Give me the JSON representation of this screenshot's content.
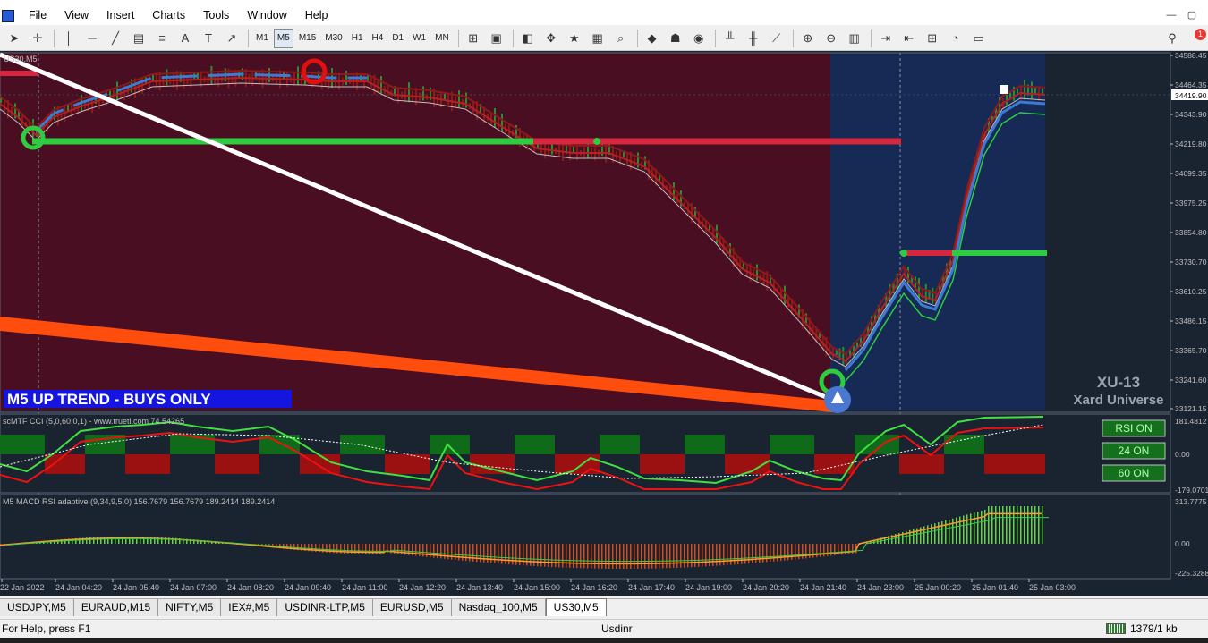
{
  "window": {
    "title": "",
    "controls": [
      "—",
      "▢"
    ]
  },
  "menu": [
    "File",
    "View",
    "Insert",
    "Charts",
    "Tools",
    "Window",
    "Help"
  ],
  "toolbar": {
    "timeframes": [
      "M1",
      "M5",
      "M15",
      "M30",
      "H1",
      "H4",
      "D1",
      "W1",
      "MN"
    ],
    "active_timeframe": "M5",
    "notification_count": "1"
  },
  "chart": {
    "symbol_label": "US30,M5",
    "price_labels": [
      "34588.45",
      "34464.35",
      "34419.90",
      "34343.90",
      "34219.80",
      "34099.35",
      "33975.25",
      "33854.80",
      "33730.70",
      "33610.25",
      "33486.15",
      "33365.70",
      "33241.60",
      "33121.15"
    ],
    "current_price": "34419.90",
    "trend_banner": "M5 UP TREND - BUYS ONLY",
    "watermark_title": "XU-13",
    "watermark_subtitle": "Xard Universe",
    "colors": {
      "bg": "#1a2330",
      "bearish_zone": "#4a0e22",
      "bullish_zone": "#162a55",
      "up": "#2ecc40",
      "down": "#d7263d",
      "ma": "#3a7bd5",
      "trendline_white": "#ffffff",
      "trendline_orange": "#ff4d0d"
    }
  },
  "cci_panel": {
    "label": "scMTF CCI (5,0,60,0,1) - www.truetl.com 74.54265",
    "levels": [
      "181.4812",
      "0.00",
      "-179.0701"
    ],
    "buttons": [
      "RSI ON",
      "24 ON",
      "60 ON"
    ]
  },
  "macd_panel": {
    "label": "M5 MACD RSI adaptive (9,34,9,5,0) 156.7679 156.7679 189.2414 189.2414",
    "levels": [
      "313.7775",
      "0.00",
      "-225.3288"
    ]
  },
  "time_axis": [
    "22 Jan 2022",
    "24 Jan 04:20",
    "24 Jan 05:40",
    "24 Jan 07:00",
    "24 Jan 08:20",
    "24 Jan 09:40",
    "24 Jan 11:00",
    "24 Jan 12:20",
    "24 Jan 13:40",
    "24 Jan 15:00",
    "24 Jan 16:20",
    "24 Jan 17:40",
    "24 Jan 19:00",
    "24 Jan 20:20",
    "24 Jan 21:40",
    "24 Jan 23:00",
    "25 Jan 00:20",
    "25 Jan 01:40",
    "25 Jan 03:00"
  ],
  "tabs": [
    "USDJPY,M5",
    "EURAUD,M15",
    "NIFTY,M5",
    "IEX#,M5",
    "USDINR-LTP,M5",
    "EURUSD,M5",
    "Nasdaq_100,M5",
    "US30,M5"
  ],
  "active_tab": "US30,M5",
  "status": {
    "help": "For Help, press F1",
    "profile": "Usdinr",
    "traffic": "1379/1 kb"
  }
}
